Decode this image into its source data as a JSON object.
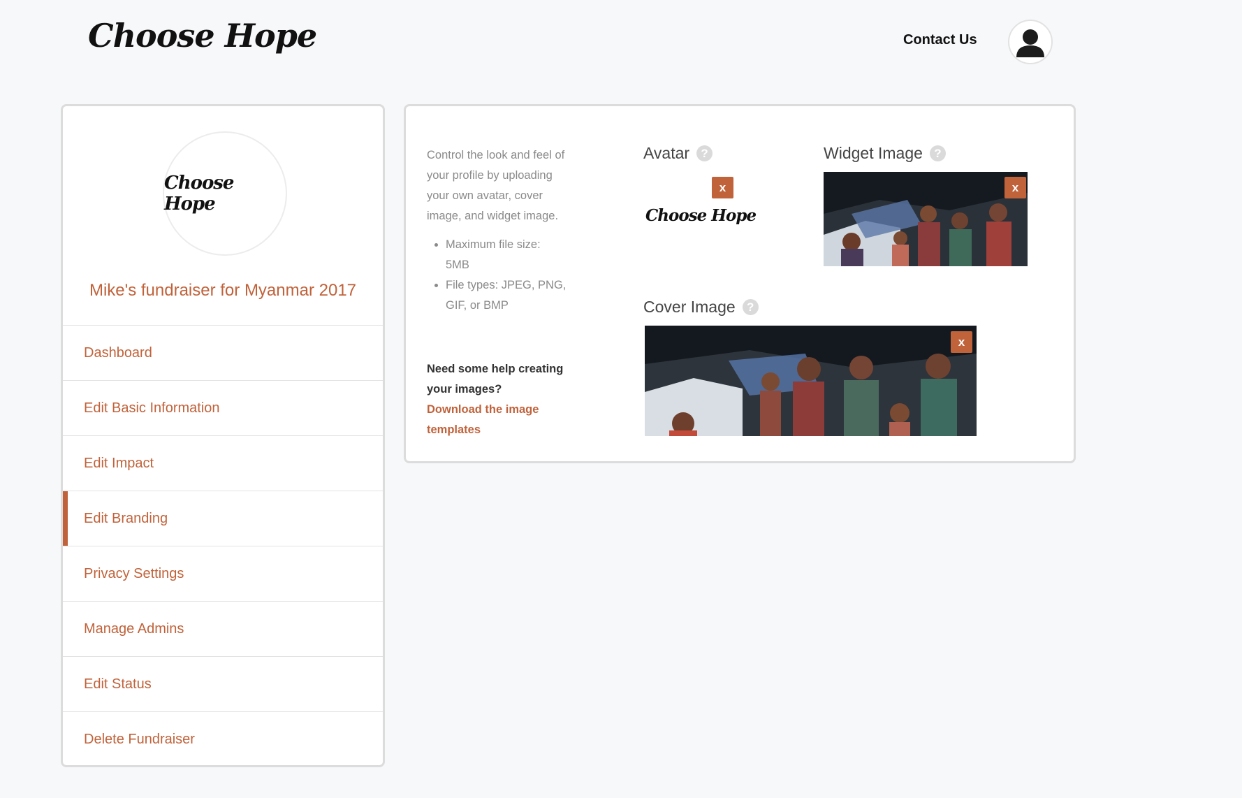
{
  "header": {
    "logo_text": "Choose Hope",
    "contact_label": "Contact Us"
  },
  "sidebar": {
    "avatar_text": "Choose Hope",
    "fundraiser_title": "Mike's fundraiser for Myanmar 2017",
    "items": [
      {
        "label": "Dashboard"
      },
      {
        "label": "Edit Basic Information"
      },
      {
        "label": "Edit Impact"
      },
      {
        "label": "Edit Branding",
        "active": true
      },
      {
        "label": "Privacy Settings"
      },
      {
        "label": "Manage Admins"
      },
      {
        "label": "Edit Status"
      },
      {
        "label": "Delete Fundraiser"
      }
    ]
  },
  "main": {
    "description": "Control the look and feel of your profile by uploading your own avatar, cover image, and widget image.",
    "limits": [
      "Maximum file size: 5MB",
      "File types: JPEG, PNG, GIF, or BMP"
    ],
    "help_question": "Need some help creating your images?",
    "help_link": "Download the image templates",
    "avatar": {
      "label": "Avatar",
      "preview_text": "Choose Hope",
      "remove_label": "x"
    },
    "widget_image": {
      "label": "Widget Image",
      "remove_label": "x"
    },
    "cover_image": {
      "label": "Cover Image",
      "remove_label": "x"
    },
    "help_icon_glyph": "?"
  },
  "colors": {
    "accent": "#c0623a",
    "background": "#f7f8fa",
    "border": "#dcdcdc"
  },
  "icons": [
    "user-avatar-icon",
    "help-icon",
    "remove-icon"
  ]
}
